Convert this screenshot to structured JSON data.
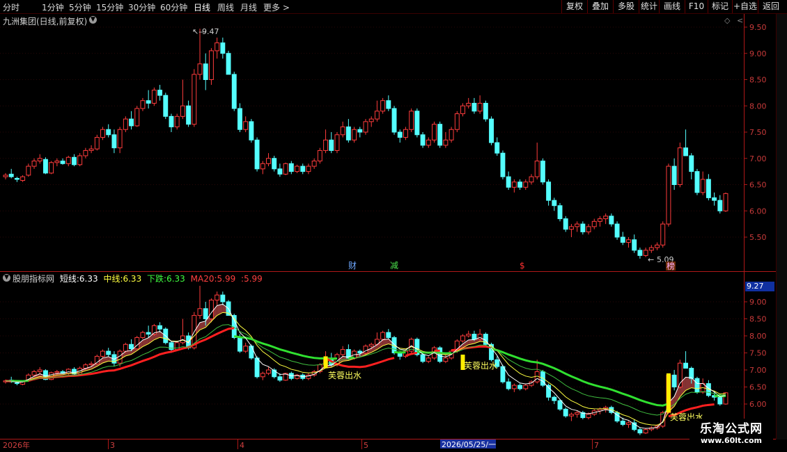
{
  "toolbar": {
    "periods": [
      "分时",
      "1分钟",
      "5分钟",
      "15分钟",
      "30分钟",
      "60分钟",
      "日线",
      "周线",
      "月线",
      "更多"
    ],
    "active_period": "日线",
    "more_arrow": ">",
    "buttons": [
      "复权",
      "叠加",
      "多股",
      "统计",
      "画线",
      "F10",
      "标记",
      "+自选",
      "返回"
    ]
  },
  "main_chart": {
    "title": "九洲集团(日线,前复权)",
    "high_label": "9.47",
    "low_label": "5.09",
    "y_ticks": [
      "9.50",
      "9.00",
      "8.50",
      "8.00",
      "7.50",
      "7.00",
      "6.50",
      "6.00",
      "5.50"
    ],
    "markers": [
      {
        "text": "财",
        "color": "#6fa8ff"
      },
      {
        "text": "减",
        "color": "#4ce04c"
      },
      {
        "text": "$",
        "color": "#ff3030"
      },
      {
        "text": "榜",
        "color": "#ffb0ff"
      }
    ]
  },
  "indicator": {
    "name": "股朋指标网",
    "items": [
      {
        "label": "短线:",
        "value": "6.33",
        "color": "#ffffff"
      },
      {
        "label": "中线:",
        "value": "6.33",
        "color": "#ffff40"
      },
      {
        "label": "下跌:",
        "value": "6.33",
        "color": "#40ff40"
      },
      {
        "label": "MA20:",
        "value": "5.99",
        "color": "#ff4040"
      },
      {
        "label": ":",
        "value": "5.99",
        "color": "#ff4040"
      }
    ],
    "current_value": "9.27",
    "y_ticks": [
      "9.00",
      "8.50",
      "8.00",
      "7.50",
      "7.00",
      "6.50",
      "6.00"
    ],
    "signal_text": "芙蓉出水"
  },
  "date_axis": {
    "labels": [
      "2026年",
      "3",
      "4",
      "5",
      "2026/05/25/一",
      "7"
    ]
  },
  "watermark": {
    "title": "乐淘公式网",
    "url": "www.60lt.com"
  },
  "chart_data": {
    "type": "candlestick",
    "title": "九洲集团(日线,前复权)",
    "ylim": [
      5.1,
      9.6
    ],
    "high": 9.47,
    "low": 5.09,
    "ohlc": [
      [
        6.65,
        6.72,
        6.6,
        6.68
      ],
      [
        6.7,
        6.8,
        6.62,
        6.65
      ],
      [
        6.62,
        6.65,
        6.55,
        6.6
      ],
      [
        6.58,
        6.68,
        6.55,
        6.65
      ],
      [
        6.68,
        6.9,
        6.65,
        6.85
      ],
      [
        6.85,
        7.0,
        6.8,
        6.95
      ],
      [
        6.95,
        7.08,
        6.9,
        7.0
      ],
      [
        6.98,
        7.02,
        6.7,
        6.72
      ],
      [
        6.72,
        6.95,
        6.7,
        6.92
      ],
      [
        6.92,
        7.0,
        6.85,
        6.95
      ],
      [
        6.95,
        7.0,
        6.88,
        6.9
      ],
      [
        6.9,
        7.05,
        6.85,
        7.02
      ],
      [
        7.02,
        7.08,
        6.85,
        6.88
      ],
      [
        6.88,
        7.1,
        6.85,
        7.05
      ],
      [
        7.05,
        7.2,
        7.0,
        7.15
      ],
      [
        7.15,
        7.25,
        7.1,
        7.18
      ],
      [
        7.18,
        7.45,
        7.15,
        7.4
      ],
      [
        7.4,
        7.6,
        7.35,
        7.55
      ],
      [
        7.55,
        7.65,
        7.4,
        7.45
      ],
      [
        7.45,
        7.55,
        7.1,
        7.2
      ],
      [
        7.2,
        7.6,
        7.1,
        7.55
      ],
      [
        7.55,
        7.8,
        7.5,
        7.75
      ],
      [
        7.75,
        7.9,
        7.55,
        7.62
      ],
      [
        7.62,
        8.0,
        7.6,
        7.95
      ],
      [
        7.95,
        8.15,
        7.9,
        8.1
      ],
      [
        8.1,
        8.3,
        7.95,
        8.05
      ],
      [
        8.05,
        8.35,
        8.0,
        8.3
      ],
      [
        8.3,
        8.4,
        8.1,
        8.2
      ],
      [
        8.2,
        8.25,
        7.75,
        7.8
      ],
      [
        7.8,
        7.85,
        7.5,
        7.6
      ],
      [
        7.6,
        7.85,
        7.55,
        7.8
      ],
      [
        7.8,
        8.5,
        7.75,
        8.0
      ],
      [
        8.0,
        8.1,
        7.6,
        7.65
      ],
      [
        7.65,
        8.7,
        7.6,
        8.6
      ],
      [
        8.6,
        9.47,
        8.5,
        8.8
      ],
      [
        8.8,
        9.0,
        8.3,
        8.5
      ],
      [
        8.5,
        9.1,
        8.4,
        9.05
      ],
      [
        9.05,
        9.3,
        8.9,
        9.2
      ],
      [
        9.2,
        9.3,
        8.9,
        9.0
      ],
      [
        9.0,
        9.05,
        8.6,
        8.6
      ],
      [
        8.6,
        8.65,
        7.9,
        7.95
      ],
      [
        7.95,
        8.05,
        7.5,
        7.55
      ],
      [
        7.55,
        7.8,
        7.5,
        7.7
      ],
      [
        7.7,
        7.75,
        7.3,
        7.35
      ],
      [
        7.35,
        7.4,
        6.75,
        6.8
      ],
      [
        6.8,
        6.95,
        6.7,
        6.9
      ],
      [
        6.9,
        7.1,
        6.85,
        7.0
      ],
      [
        7.0,
        7.05,
        6.75,
        6.8
      ],
      [
        6.8,
        6.9,
        6.65,
        6.7
      ],
      [
        6.7,
        6.92,
        6.68,
        6.9
      ],
      [
        6.9,
        6.95,
        6.7,
        6.75
      ],
      [
        6.75,
        6.88,
        6.72,
        6.85
      ],
      [
        6.85,
        6.9,
        6.7,
        6.75
      ],
      [
        6.75,
        6.9,
        6.7,
        6.85
      ],
      [
        6.85,
        7.0,
        6.8,
        6.95
      ],
      [
        6.95,
        7.2,
        6.9,
        7.15
      ],
      [
        7.15,
        7.55,
        7.1,
        7.35
      ],
      [
        7.35,
        7.5,
        7.1,
        7.15
      ],
      [
        7.15,
        7.5,
        7.1,
        7.45
      ],
      [
        7.45,
        7.7,
        7.4,
        7.6
      ],
      [
        7.6,
        7.75,
        7.3,
        7.35
      ],
      [
        7.35,
        7.6,
        7.3,
        7.55
      ],
      [
        7.55,
        7.6,
        7.4,
        7.5
      ],
      [
        7.5,
        7.75,
        7.45,
        7.7
      ],
      [
        7.7,
        7.8,
        7.6,
        7.75
      ],
      [
        7.75,
        8.1,
        7.7,
        7.9
      ],
      [
        7.9,
        8.15,
        7.85,
        8.1
      ],
      [
        8.1,
        8.2,
        7.9,
        7.95
      ],
      [
        7.95,
        8.0,
        7.45,
        7.5
      ],
      [
        7.5,
        7.55,
        7.3,
        7.4
      ],
      [
        7.4,
        7.6,
        7.35,
        7.55
      ],
      [
        7.55,
        7.95,
        7.5,
        7.9
      ],
      [
        7.9,
        7.95,
        7.4,
        7.45
      ],
      [
        7.45,
        7.5,
        7.2,
        7.25
      ],
      [
        7.25,
        7.4,
        7.2,
        7.35
      ],
      [
        7.35,
        7.7,
        7.3,
        7.65
      ],
      [
        7.65,
        7.7,
        7.2,
        7.25
      ],
      [
        7.25,
        7.5,
        7.2,
        7.35
      ],
      [
        7.35,
        7.6,
        7.3,
        7.55
      ],
      [
        7.55,
        7.9,
        7.5,
        7.85
      ],
      [
        7.85,
        8.05,
        7.8,
        8.0
      ],
      [
        8.0,
        8.15,
        7.95,
        8.05
      ],
      [
        8.05,
        8.15,
        7.85,
        7.9
      ],
      [
        7.9,
        8.2,
        7.85,
        8.05
      ],
      [
        8.05,
        8.1,
        7.7,
        7.75
      ],
      [
        7.75,
        7.8,
        7.25,
        7.3
      ],
      [
        7.3,
        7.4,
        7.05,
        7.1
      ],
      [
        7.1,
        7.15,
        6.6,
        6.65
      ],
      [
        6.65,
        6.75,
        6.4,
        6.45
      ],
      [
        6.45,
        6.6,
        6.35,
        6.55
      ],
      [
        6.55,
        6.6,
        6.4,
        6.45
      ],
      [
        6.45,
        6.6,
        6.4,
        6.55
      ],
      [
        6.55,
        6.7,
        6.5,
        6.65
      ],
      [
        6.65,
        7.3,
        6.6,
        6.95
      ],
      [
        6.95,
        7.0,
        6.5,
        6.55
      ],
      [
        6.55,
        6.6,
        6.1,
        6.2
      ],
      [
        6.2,
        6.25,
        6.0,
        6.1
      ],
      [
        6.1,
        6.15,
        5.8,
        5.85
      ],
      [
        5.85,
        5.9,
        5.6,
        5.65
      ],
      [
        5.65,
        5.75,
        5.5,
        5.7
      ],
      [
        5.7,
        5.8,
        5.6,
        5.75
      ],
      [
        5.75,
        5.8,
        5.55,
        5.6
      ],
      [
        5.6,
        5.75,
        5.55,
        5.7
      ],
      [
        5.7,
        5.85,
        5.65,
        5.8
      ],
      [
        5.8,
        5.9,
        5.7,
        5.85
      ],
      [
        5.85,
        5.95,
        5.75,
        5.9
      ],
      [
        5.9,
        5.95,
        5.7,
        5.75
      ],
      [
        5.75,
        5.8,
        5.45,
        5.5
      ],
      [
        5.5,
        5.6,
        5.35,
        5.4
      ],
      [
        5.4,
        5.5,
        5.3,
        5.45
      ],
      [
        5.45,
        5.55,
        5.2,
        5.25
      ],
      [
        5.25,
        5.3,
        5.09,
        5.15
      ],
      [
        5.15,
        5.3,
        5.12,
        5.25
      ],
      [
        5.25,
        5.35,
        5.2,
        5.3
      ],
      [
        5.3,
        5.4,
        5.25,
        5.35
      ],
      [
        5.35,
        5.8,
        5.3,
        5.75
      ],
      [
        5.75,
        6.9,
        5.7,
        6.85
      ],
      [
        6.85,
        7.0,
        6.4,
        6.5
      ],
      [
        6.5,
        7.3,
        6.45,
        7.2
      ],
      [
        7.2,
        7.55,
        7.1,
        7.05
      ],
      [
        7.05,
        7.1,
        6.6,
        6.75
      ],
      [
        6.75,
        6.8,
        6.3,
        6.35
      ],
      [
        6.35,
        6.75,
        6.3,
        6.6
      ],
      [
        6.6,
        6.7,
        6.2,
        6.25
      ],
      [
        6.25,
        6.35,
        6.1,
        6.2
      ],
      [
        6.2,
        6.3,
        5.95,
        6.0
      ],
      [
        6.0,
        6.35,
        5.98,
        6.33
      ]
    ]
  }
}
